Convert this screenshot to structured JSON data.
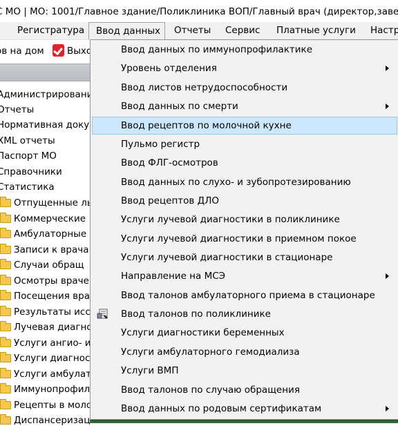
{
  "window": {
    "title": "С МО | МО: 1001/Главное здание/Поликлиника ВОП/Главный врач (директор,завед"
  },
  "menubar": {
    "items": [
      {
        "label": "Регистратура"
      },
      {
        "label": "Ввод данных"
      },
      {
        "label": "Отчеты"
      },
      {
        "label": "Сервис"
      },
      {
        "label": "Платные услуги"
      },
      {
        "label": "Настр"
      }
    ]
  },
  "toolbar": {
    "home_visits_label": "ов на дом",
    "exit_label": "Выхо",
    "exit_icon": "exit-checkmark-icon"
  },
  "tree": {
    "items": [
      {
        "label": "Администрировани",
        "folder": false
      },
      {
        "label": "Отчеты",
        "folder": false
      },
      {
        "label": "Нормативная доку",
        "folder": false
      },
      {
        "label": "XML отчеты",
        "folder": false
      },
      {
        "label": "Паспорт МО",
        "folder": false
      },
      {
        "label": "Справочники",
        "folder": false
      },
      {
        "label": "Статистика",
        "folder": false
      },
      {
        "label": "Отпущенные лы",
        "folder": true
      },
      {
        "label": "Коммерческие",
        "folder": true
      },
      {
        "label": "Амбулаторные",
        "folder": true
      },
      {
        "label": "Записи к врача",
        "folder": true
      },
      {
        "label": "Случаи обращ",
        "folder": true
      },
      {
        "label": "Осмотры враче",
        "folder": true
      },
      {
        "label": "Посещения вра",
        "folder": true
      },
      {
        "label": "Результаты исс",
        "folder": true
      },
      {
        "label": "Лучевая диагно",
        "folder": true
      },
      {
        "label": "Услуги ангио- и",
        "folder": true
      },
      {
        "label": "Услуги диагнос",
        "folder": true
      },
      {
        "label": "Услуги амбулат",
        "folder": true
      },
      {
        "label": "Иммунопрофил",
        "folder": true
      },
      {
        "label": "Рецепты в моло",
        "folder": true
      },
      {
        "label": "Диспансеризаци",
        "folder": true
      }
    ]
  },
  "dropdown": {
    "items": [
      {
        "label": "Ввод данных по иммунопрофилактике",
        "submenu": false
      },
      {
        "label": "Уровень отделения",
        "submenu": true
      },
      {
        "label": "Ввод листов нетрудоспособности",
        "submenu": false
      },
      {
        "label": "Ввод данных по смерти",
        "submenu": true
      },
      {
        "label": "Ввод рецептов по молочной кухне",
        "submenu": false,
        "highlighted": true
      },
      {
        "label": "Пульмо регистр",
        "submenu": false
      },
      {
        "label": "Ввод ФЛГ-осмотров",
        "submenu": false
      },
      {
        "label": "Ввод данных по слухо- и зубопротезированию",
        "submenu": false
      },
      {
        "label": "Ввод рецептов ДЛО",
        "submenu": false
      },
      {
        "label": "Услуги лучевой диагностики в поликлинике",
        "submenu": false
      },
      {
        "label": "Услуги лучевой диагностики в приемном покое",
        "submenu": false
      },
      {
        "label": "Услуги лучевой диагностики в стационаре",
        "submenu": false
      },
      {
        "label": "Направление на МСЭ",
        "submenu": true
      },
      {
        "label": "Ввод талонов амбулаторного приема в стационаре",
        "submenu": false
      },
      {
        "label": "Ввод талонов по поликлинике",
        "submenu": false,
        "icon": "document-form-icon"
      },
      {
        "label": "Услуги диагностики беременных",
        "submenu": false
      },
      {
        "label": "Услуги амбулаторного гемодиализа",
        "submenu": false
      },
      {
        "label": "Услуги ВМП",
        "submenu": false
      },
      {
        "label": "Ввод талонов по случаю обращения",
        "submenu": false
      },
      {
        "label": "Ввод данных по родовым сертификатам",
        "submenu": true
      }
    ]
  }
}
